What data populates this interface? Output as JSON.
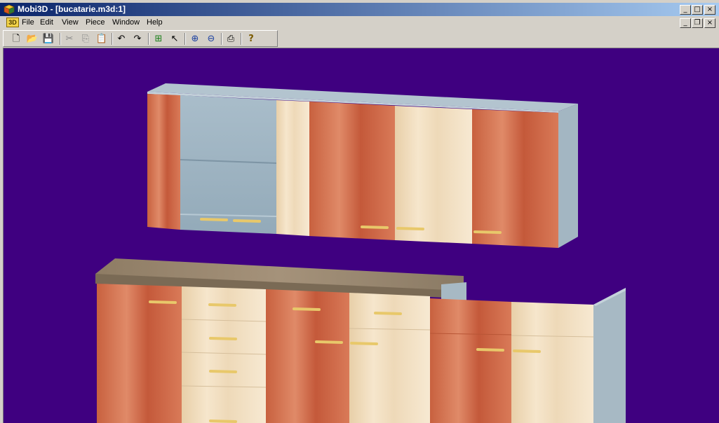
{
  "window": {
    "title": "Mobi3D - [bucatarie.m3d:1]",
    "icon": "app-cube-icon",
    "controls": {
      "minimize": "_",
      "maximize": "□",
      "close": "×"
    }
  },
  "menubar": {
    "doc_icon_label": "3D",
    "items": [
      "File",
      "Edit",
      "View",
      "Piece",
      "Window",
      "Help"
    ],
    "mdi_controls": {
      "minimize": "_",
      "restore": "❐",
      "close": "×"
    }
  },
  "toolbar": {
    "buttons": [
      {
        "name": "new-file",
        "glyph": "🗋"
      },
      {
        "name": "open-folder",
        "glyph": "📂"
      },
      {
        "name": "save",
        "glyph": "💾"
      },
      {
        "name": "cut",
        "glyph": "✂"
      },
      {
        "name": "copy",
        "glyph": "⎘"
      },
      {
        "name": "paste",
        "glyph": "📋"
      },
      {
        "name": "undo",
        "glyph": "↶"
      },
      {
        "name": "redo",
        "glyph": "↷"
      },
      {
        "name": "add-piece",
        "glyph": "⊞"
      },
      {
        "name": "select-pointer",
        "glyph": "↖"
      },
      {
        "name": "zoom-in",
        "glyph": "⊕"
      },
      {
        "name": "zoom-out",
        "glyph": "⊖"
      },
      {
        "name": "print",
        "glyph": "⎙"
      },
      {
        "name": "help",
        "glyph": "?"
      }
    ]
  },
  "viewport": {
    "background": "#3f0080",
    "scene": "3D kitchen cabinets model",
    "colors": {
      "cherry_wood": "#cf6c4c",
      "maple_wood": "#f1dcbc",
      "glass": "#a8bcc8",
      "cabinet_side": "#a7b9c4",
      "countertop": "#9b8a72",
      "handle": "#e8c86a"
    }
  }
}
